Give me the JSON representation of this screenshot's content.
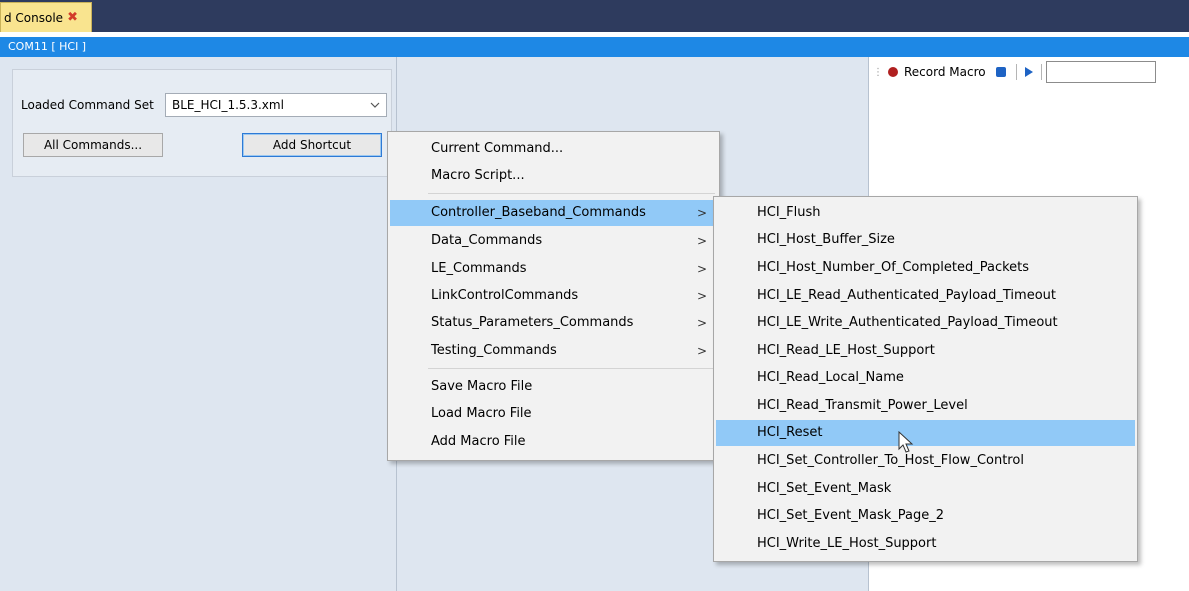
{
  "tab": {
    "title": "d Console",
    "close_glyph": "✖"
  },
  "titlebar": {
    "text": "COM11 [ HCI ]"
  },
  "command_set": {
    "label": "Loaded Command Set",
    "selected": "BLE_HCI_1.5.3.xml",
    "all_commands_label": "All Commands...",
    "add_shortcut_label": "Add Shortcut"
  },
  "toolbar": {
    "record_label": "Record Macro",
    "input_value": ""
  },
  "menu_main": {
    "items": [
      {
        "label": "Current Command...",
        "submenu": false
      },
      {
        "label": "Macro Script...",
        "submenu": false
      },
      {
        "label": "Controller_Baseband_Commands",
        "submenu": true,
        "highlighted": true
      },
      {
        "label": "Data_Commands",
        "submenu": true
      },
      {
        "label": "LE_Commands",
        "submenu": true
      },
      {
        "label": "LinkControlCommands",
        "submenu": true
      },
      {
        "label": "Status_Parameters_Commands",
        "submenu": true
      },
      {
        "label": "Testing_Commands",
        "submenu": true
      },
      {
        "label": "Save Macro File",
        "submenu": false
      },
      {
        "label": "Load Macro File",
        "submenu": false
      },
      {
        "label": "Add Macro File",
        "submenu": false
      }
    ],
    "arrow_glyph": ">"
  },
  "menu_sub": {
    "items": [
      {
        "label": "HCI_Flush"
      },
      {
        "label": "HCI_Host_Buffer_Size"
      },
      {
        "label": "HCI_Host_Number_Of_Completed_Packets"
      },
      {
        "label": "HCI_LE_Read_Authenticated_Payload_Timeout"
      },
      {
        "label": "HCI_LE_Write_Authenticated_Payload_Timeout"
      },
      {
        "label": "HCI_Read_LE_Host_Support"
      },
      {
        "label": "HCI_Read_Local_Name"
      },
      {
        "label": "HCI_Read_Transmit_Power_Level"
      },
      {
        "label": "HCI_Reset",
        "highlighted": true
      },
      {
        "label": "HCI_Set_Controller_To_Host_Flow_Control"
      },
      {
        "label": "HCI_Set_Event_Mask"
      },
      {
        "label": "HCI_Set_Event_Mask_Page_2"
      },
      {
        "label": "HCI_Write_LE_Host_Support"
      }
    ]
  },
  "icons": {
    "tab_close": "close-x-icon",
    "record": "record-dot-icon",
    "stop": "stop-icon",
    "play": "play-icon",
    "dropdown": "chevron-down-icon",
    "submenu": "chevron-right-icon",
    "cursor": "mouse-pointer-icon"
  },
  "colors": {
    "tabstrip": "#2e3b5e",
    "titlebar": "#1e88e5",
    "highlight": "#91c9f7",
    "record": "#b02020",
    "accent": "#1e63c4"
  }
}
